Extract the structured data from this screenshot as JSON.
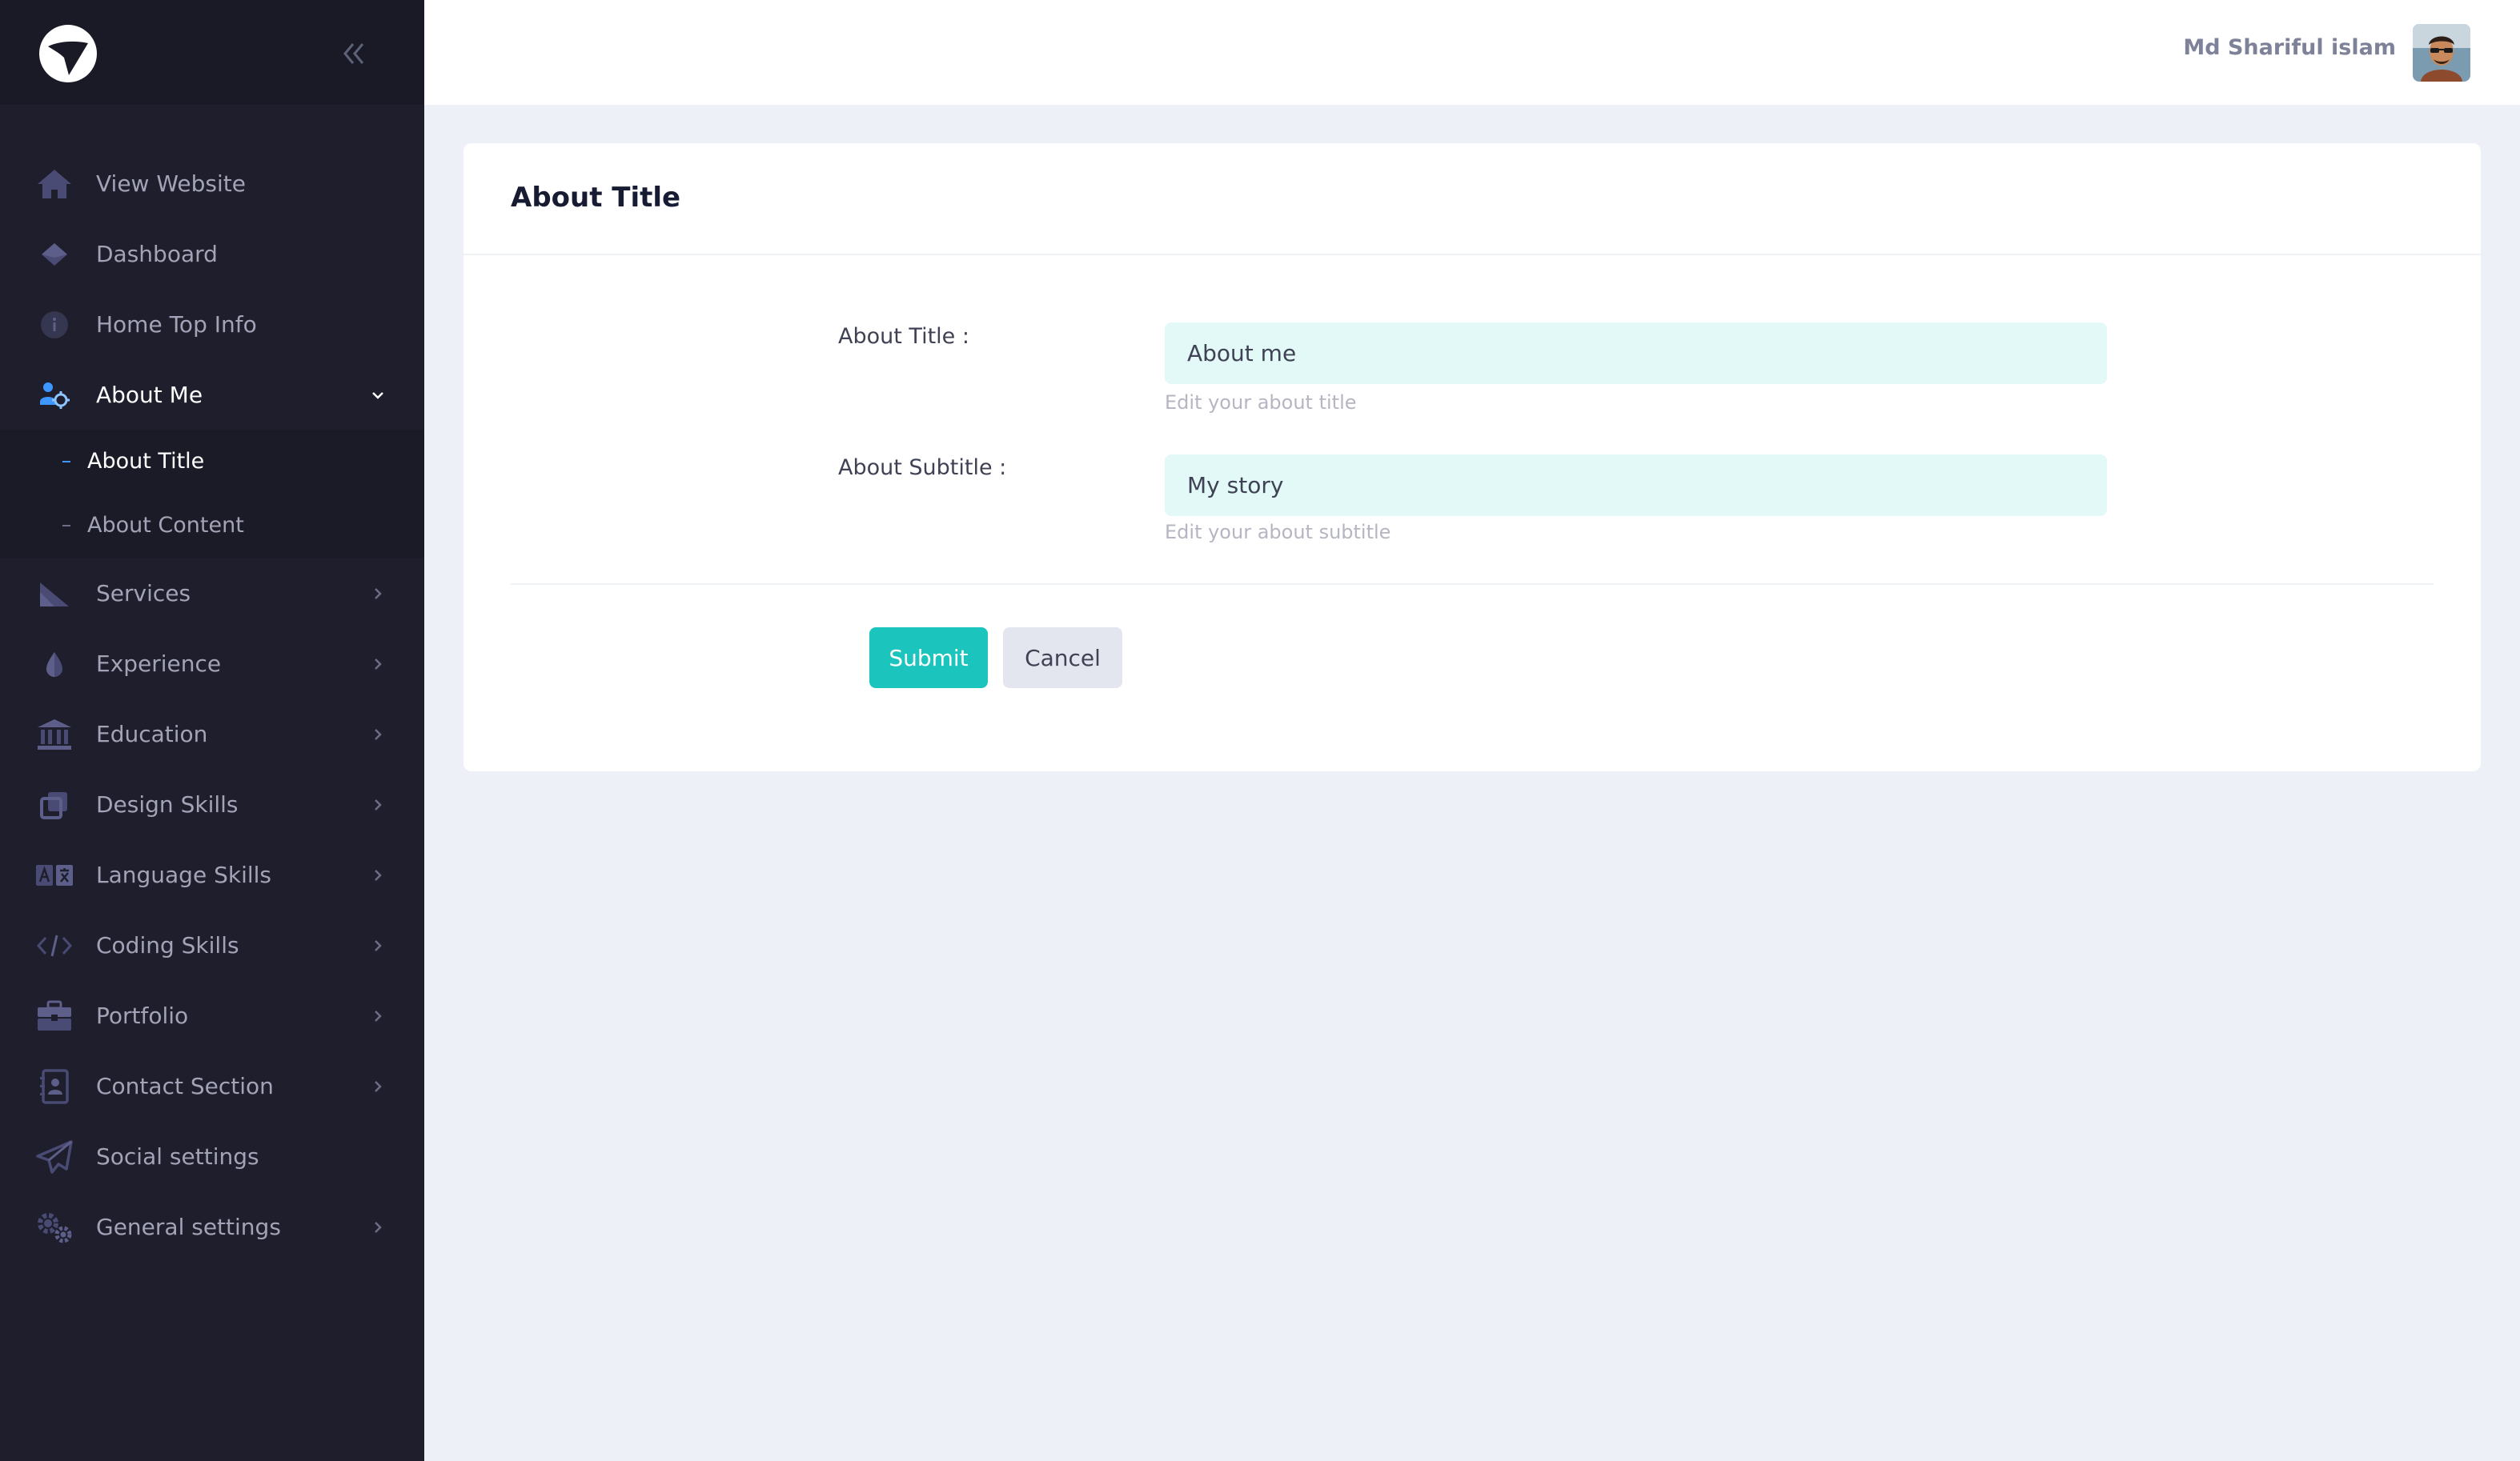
{
  "sidebar": {
    "items": [
      {
        "label": "View Website",
        "icon": "home-icon",
        "active": false,
        "has_chevron": false
      },
      {
        "label": "Dashboard",
        "icon": "diamond-icon",
        "active": false,
        "has_chevron": false
      },
      {
        "label": "Home Top Info",
        "icon": "info-icon",
        "active": false,
        "has_chevron": false
      },
      {
        "label": "About Me",
        "icon": "about-me-icon",
        "active": true,
        "has_chevron": true,
        "expanded": true,
        "children": [
          {
            "label": "About Title",
            "active": true
          },
          {
            "label": "About Content",
            "active": false
          }
        ]
      },
      {
        "label": "Services",
        "icon": "services-icon",
        "has_chevron": true
      },
      {
        "label": "Experience",
        "icon": "drop-icon",
        "has_chevron": true
      },
      {
        "label": "Education",
        "icon": "bank-icon",
        "has_chevron": true
      },
      {
        "label": "Design Skills",
        "icon": "design-icon",
        "has_chevron": true
      },
      {
        "label": "Language Skills",
        "icon": "translate-icon",
        "has_chevron": true
      },
      {
        "label": "Coding Skills",
        "icon": "code-icon",
        "has_chevron": true
      },
      {
        "label": "Portfolio",
        "icon": "briefcase-icon",
        "has_chevron": true
      },
      {
        "label": "Contact Section",
        "icon": "contact-book-icon",
        "has_chevron": true
      },
      {
        "label": "Social settings",
        "icon": "send-icon",
        "has_chevron": false
      },
      {
        "label": "General settings",
        "icon": "gears-icon",
        "has_chevron": true
      }
    ]
  },
  "header": {
    "user_name": "Md Shariful islam"
  },
  "card": {
    "title": "About Title",
    "fields": [
      {
        "label": "About Title :",
        "value": "About me",
        "hint": "Edit your about title"
      },
      {
        "label": "About Subtitle :",
        "value": "My story",
        "hint": "Edit your about subtitle"
      }
    ],
    "submit_label": "Submit",
    "cancel_label": "Cancel"
  },
  "colors": {
    "sidebar_bg": "#1e1e2d",
    "sidebar_header_bg": "#1a1a27",
    "accent_teal": "#1bc5bd",
    "input_bg": "#e2f9f8",
    "active_icon_blue": "#3e97ff",
    "page_bg": "#eef0f8"
  }
}
